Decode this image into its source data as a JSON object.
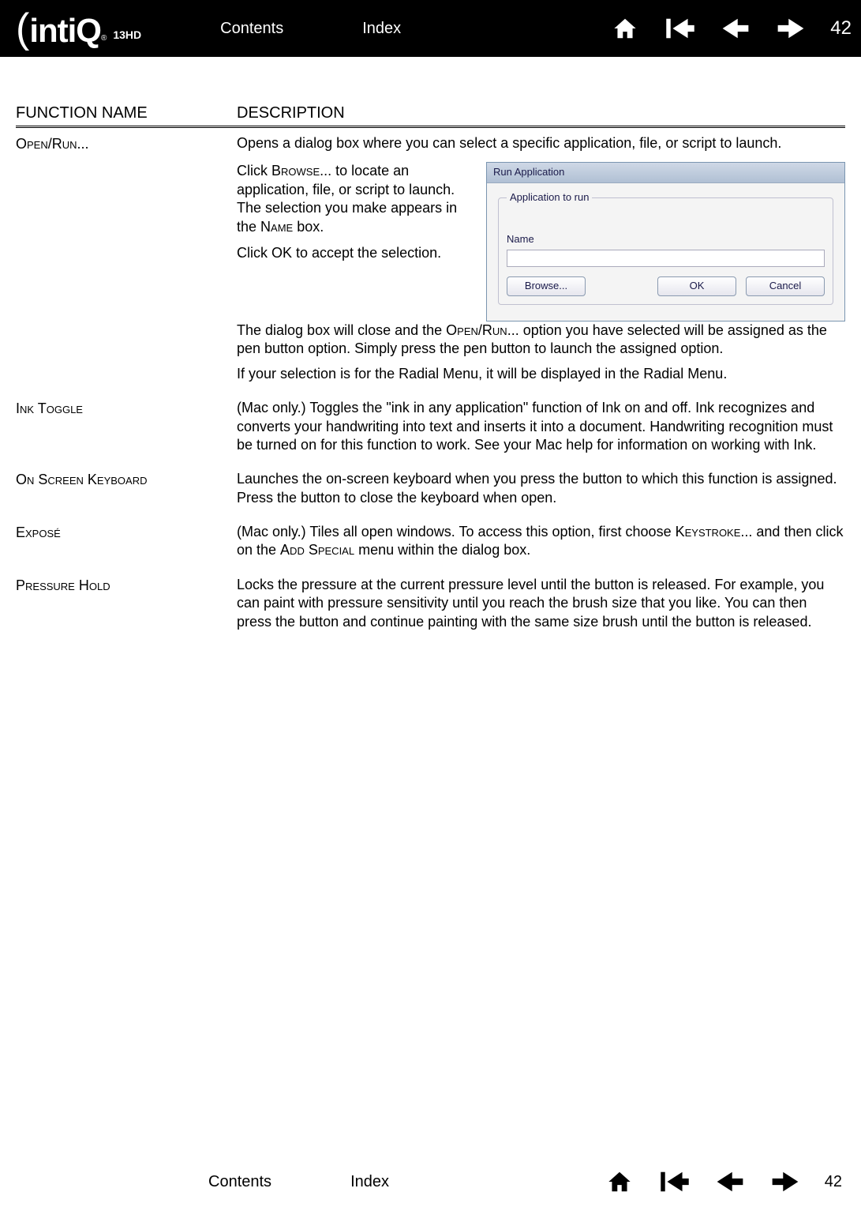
{
  "header": {
    "logo_main": "intiQ",
    "logo_sub": "13HD",
    "contents": "Contents",
    "index": "Index",
    "page": "42"
  },
  "table": {
    "col1": "FUNCTION NAME",
    "col2": "DESCRIPTION"
  },
  "rows": {
    "openrun": {
      "name": "Open/Run...",
      "p1": "Opens a dialog box where you can select a specific application, file, or script to launch.",
      "p2a": "Click ",
      "p2b": "Browse",
      "p2c": "... to locate an application, file, or script to launch. The selection you make appears in the ",
      "p2d": "Name",
      "p2e": " box.",
      "p3": "Click OK to accept the selection.",
      "p4a": "The dialog box will close and the ",
      "p4b": "Open/Run",
      "p4c": "... option you have selected will be assigned as the pen button option. Simply press the pen button to launch the assigned option.",
      "p5": "If your selection is for the Radial Menu, it will be displayed in the Radial Menu."
    },
    "ink": {
      "name": "Ink Toggle",
      "desc": "(Mac only.) Toggles the \"ink in any application\" function of Ink on and off. Ink recognizes and converts your handwriting into text and inserts it into a document. Handwriting recognition must be turned on for this function to work. See your Mac help for information on working with Ink."
    },
    "osk": {
      "name": "On Screen Keyboard",
      "desc": "Launches the on-screen keyboard when you press the button to which this function is assigned. Press the button to close the keyboard when open."
    },
    "expose": {
      "name": "Exposé",
      "d1": "(Mac only.) Tiles all open windows. To access this option, first choose ",
      "d2": "Keystroke",
      "d3": "... and then click on the ",
      "d4": "Add Special",
      "d5": " menu within the dialog box."
    },
    "phold": {
      "name": "Pressure Hold",
      "desc": "Locks the pressure at the current pressure level until the button is released. For example, you can paint with pressure sensitivity until you reach the brush size that you like. You can then press the button and continue painting with the same size brush until the button is released."
    }
  },
  "dialog": {
    "title": "Run Application",
    "legend": "Application to run",
    "name_lbl": "Name",
    "browse": "Browse...",
    "ok": "OK",
    "cancel": "Cancel"
  },
  "footer": {
    "contents": "Contents",
    "index": "Index",
    "page": "42"
  }
}
